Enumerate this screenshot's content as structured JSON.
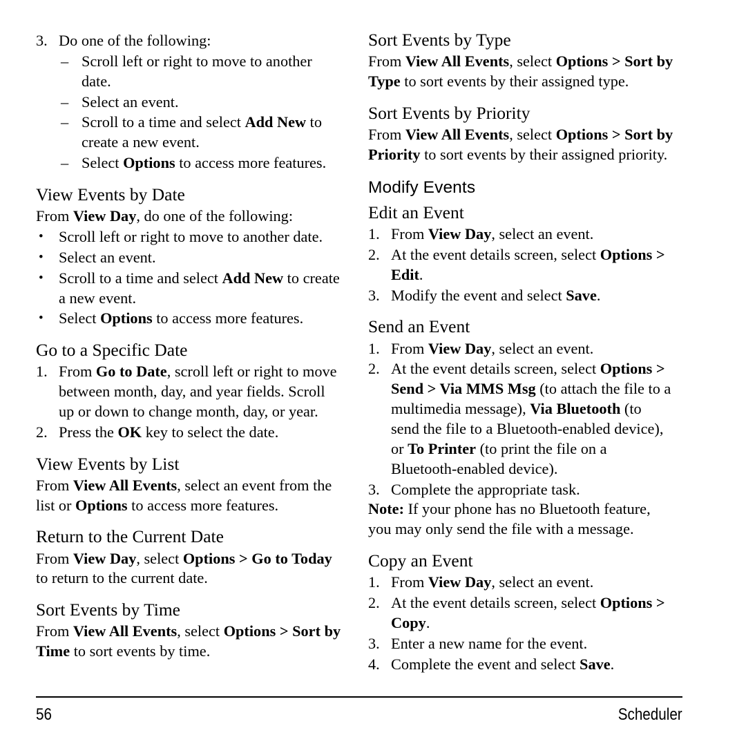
{
  "footer": {
    "page_number": "56",
    "section_title": "Scheduler"
  },
  "left_column": {
    "step3": {
      "marker": "3.",
      "text": "Do one of the following:",
      "dash_marker": "–",
      "items": [
        {
          "plain1": "Scroll left or right to move to another date.",
          "bold": "",
          "plain2": ""
        },
        {
          "plain1": "Select an event.",
          "bold": "",
          "plain2": ""
        },
        {
          "plain1": "Scroll to a time and select ",
          "bold": "Add New",
          "plain2": " to create a new event."
        },
        {
          "plain1": "Select ",
          "bold": "Options",
          "plain2": " to access more features."
        }
      ]
    },
    "view_events_by_date": {
      "heading": "View Events by Date",
      "intro_pre": "From ",
      "intro_bold": "View Day",
      "intro_post": ", do one of the following:",
      "bullet_marker": "•",
      "items": [
        {
          "plain1": "Scroll left or right to move to another date.",
          "bold": "",
          "plain2": ""
        },
        {
          "plain1": "Select an event.",
          "bold": "",
          "plain2": ""
        },
        {
          "plain1": "Scroll to a time and select ",
          "bold": "Add New",
          "plain2": " to create a new event."
        },
        {
          "plain1": "Select ",
          "bold": "Options",
          "plain2": " to access more features."
        }
      ]
    },
    "go_to_specific_date": {
      "heading": "Go to a Specific Date",
      "steps": [
        {
          "marker": "1.",
          "plain1": "From ",
          "bold": "Go to Date",
          "plain2": ", scroll left or right to move between month, day, and year fields. Scroll up or down to change month, day, or year."
        },
        {
          "marker": "2.",
          "plain1": "Press the ",
          "bold": "OK",
          "plain2": " key to select the date."
        }
      ]
    },
    "view_events_by_list": {
      "heading": "View Events by List",
      "pre": "From ",
      "bold1": "View All Events",
      "mid": ", select an event from the list or ",
      "bold2": "Options",
      "post": " to access more features."
    },
    "return_to_current_date": {
      "heading": "Return to the Current Date",
      "pre": "From ",
      "bold1": "View Day",
      "mid": ", select ",
      "bold2": "Options > Go to Today",
      "post": " to return to the current date."
    },
    "sort_events_by_time": {
      "heading": "Sort Events by Time",
      "pre": "From ",
      "bold1": "View All Events",
      "mid": ", select ",
      "bold2": "Options > Sort by Time",
      "post": " to sort events by time."
    }
  },
  "right_column": {
    "sort_events_by_type": {
      "heading": "Sort Events by Type",
      "pre": "From ",
      "bold1": "View All Events",
      "mid": ", select ",
      "bold2": "Options > Sort by Type",
      "post": " to sort events by their assigned type."
    },
    "sort_events_by_priority": {
      "heading": "Sort Events by Priority",
      "pre": "From ",
      "bold1": "View All Events",
      "mid": ", select ",
      "bold2": "Options > Sort by Priority",
      "post": " to sort events by their assigned priority."
    },
    "modify_events_heading": "Modify Events",
    "edit_an_event": {
      "heading": "Edit an Event",
      "steps": [
        {
          "marker": "1.",
          "plain1": "From ",
          "bold": "View Day",
          "plain2": ", select an event."
        },
        {
          "marker": "2.",
          "plain1": "At the event details screen, select ",
          "bold": "Options > Edit",
          "plain2": "."
        },
        {
          "marker": "3.",
          "plain1": "Modify the event and select ",
          "bold": "Save",
          "plain2": "."
        }
      ]
    },
    "send_an_event": {
      "heading": "Send an Event",
      "step1": {
        "marker": "1.",
        "plain1": "From ",
        "bold": "View Day",
        "plain2": ", select an event."
      },
      "step2": {
        "marker": "2.",
        "t1": "At the event details screen, select ",
        "b1": "Options > Send > Via MMS Msg",
        "t2": " (to attach the file to a multimedia message), ",
        "b2": "Via Bluetooth",
        "t3": " (to send the file to a Bluetooth-enabled device), or ",
        "b3": "To Printer",
        "t4": " (to print the file on a Bluetooth-enabled device)."
      },
      "step3": {
        "marker": "3.",
        "plain1": "Complete the appropriate task.",
        "bold": "",
        "plain2": ""
      },
      "note_label": "Note:",
      "note_text": " If your phone has no Bluetooth feature, you may only send the file with a message."
    },
    "copy_an_event": {
      "heading": "Copy an Event",
      "steps": [
        {
          "marker": "1.",
          "plain1": "From ",
          "bold": "View Day",
          "plain2": ", select an event."
        },
        {
          "marker": "2.",
          "plain1": "At the event details screen, select ",
          "bold": "Options > Copy",
          "plain2": "."
        },
        {
          "marker": "3.",
          "plain1": "Enter a new name for the event.",
          "bold": "",
          "plain2": ""
        },
        {
          "marker": "4.",
          "plain1": "Complete the event and select ",
          "bold": "Save",
          "plain2": "."
        }
      ]
    }
  }
}
